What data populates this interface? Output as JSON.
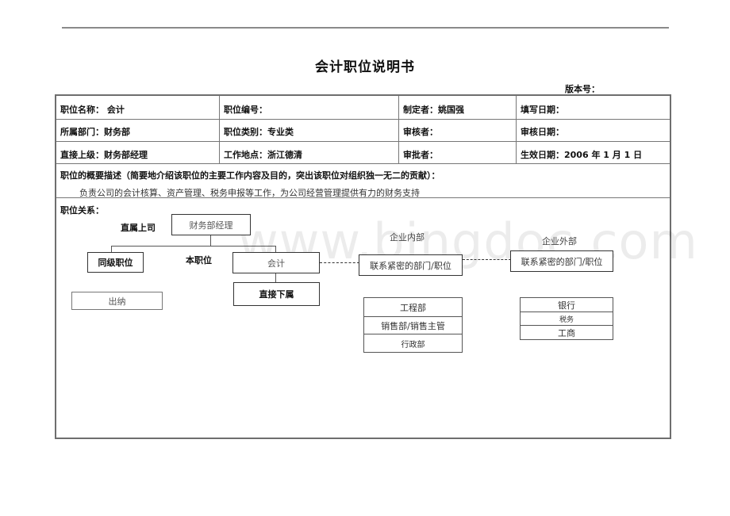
{
  "document": {
    "title": "会计职位说明书",
    "version_label": "版本号："
  },
  "info_table": {
    "rows": [
      [
        "职位名称：  会计",
        "职位编号：",
        "制定者：姚国强",
        "填写日期："
      ],
      [
        "所属部门：财务部",
        "职位类别：专业类",
        "审核者：",
        "审核日期："
      ],
      [
        "直接上级：财务部经理",
        "工作地点：浙江德清",
        "审批者：",
        "生效日期：2006 年 1 月 1 日"
      ]
    ]
  },
  "summary": {
    "label": "职位的概要描述（简要地介绍该职位的主要工作内容及目的，突出该职位对组织独一无二的贡献）：",
    "text": "负责公司的会计核算、资产管理、税务申报等工作，为公司经营管理提供有力的财务支持"
  },
  "relations": {
    "label": "职位关系：",
    "superior_label": "直属上司",
    "superior_box": "财务部经理",
    "peer_box": "同级职位",
    "self_label": "本职位",
    "self_box": "会计",
    "subordinate_box": "直接下属",
    "peer_item": "出纳",
    "internal": {
      "label": "企业内部",
      "box": "联系紧密的部门/职位",
      "items": [
        "工程部",
        "销售部/销售主管",
        "行政部"
      ]
    },
    "external": {
      "label": "企业外部",
      "box": "联系紧密的部门/职位",
      "items": [
        "银行",
        "税务",
        "工商"
      ]
    }
  },
  "watermark": "www.bingdoc.com"
}
